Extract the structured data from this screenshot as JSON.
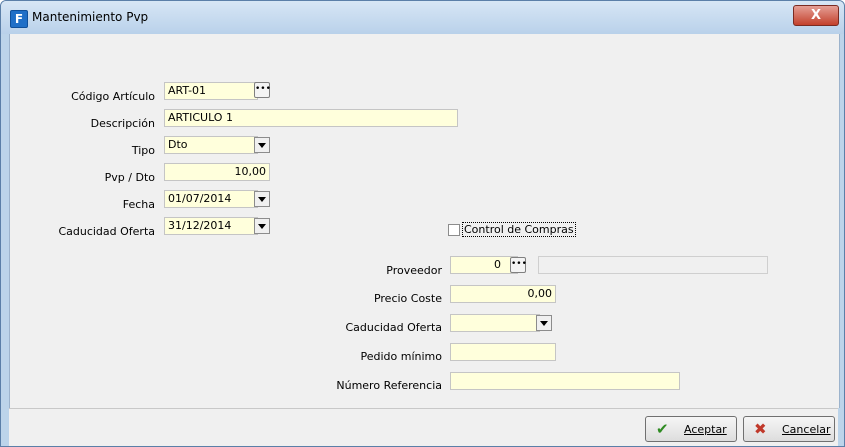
{
  "window": {
    "title": "Mantenimiento Pvp",
    "close_symbol": "X"
  },
  "form": {
    "codigo": {
      "label": "Código Artículo",
      "value": "ART-01"
    },
    "descripcion": {
      "label": "Descripción",
      "value": "ARTICULO 1"
    },
    "tipo": {
      "label": "Tipo",
      "value": "Dto"
    },
    "pvp": {
      "label": "Pvp / Dto",
      "value": "10,00"
    },
    "fecha": {
      "label": "Fecha",
      "value": "01/07/2014"
    },
    "caducidad": {
      "label": "Caducidad Oferta",
      "value": "31/12/2014"
    },
    "control": {
      "label": "Control de Compras",
      "checked": false
    }
  },
  "compras": {
    "proveedor": {
      "label": "Proveedor",
      "value": "0",
      "name_value": ""
    },
    "precio": {
      "label": "Precio Coste",
      "value": "0,00"
    },
    "caducidad": {
      "label": "Caducidad Oferta",
      "value": ""
    },
    "pedido": {
      "label": "Pedido mínimo",
      "value": ""
    },
    "referencia": {
      "label": "Número Referencia",
      "value": ""
    }
  },
  "buttons": {
    "accept": {
      "label": "Aceptar",
      "icon": "checkmark-icon",
      "color": "#2e8b22"
    },
    "cancel": {
      "label": "Cancelar",
      "icon": "x-icon",
      "color": "#c0392b"
    }
  },
  "icons": {
    "lookup": "ellipsis-icon",
    "dropdown": "chevron-down-icon",
    "app": "app-icon"
  }
}
